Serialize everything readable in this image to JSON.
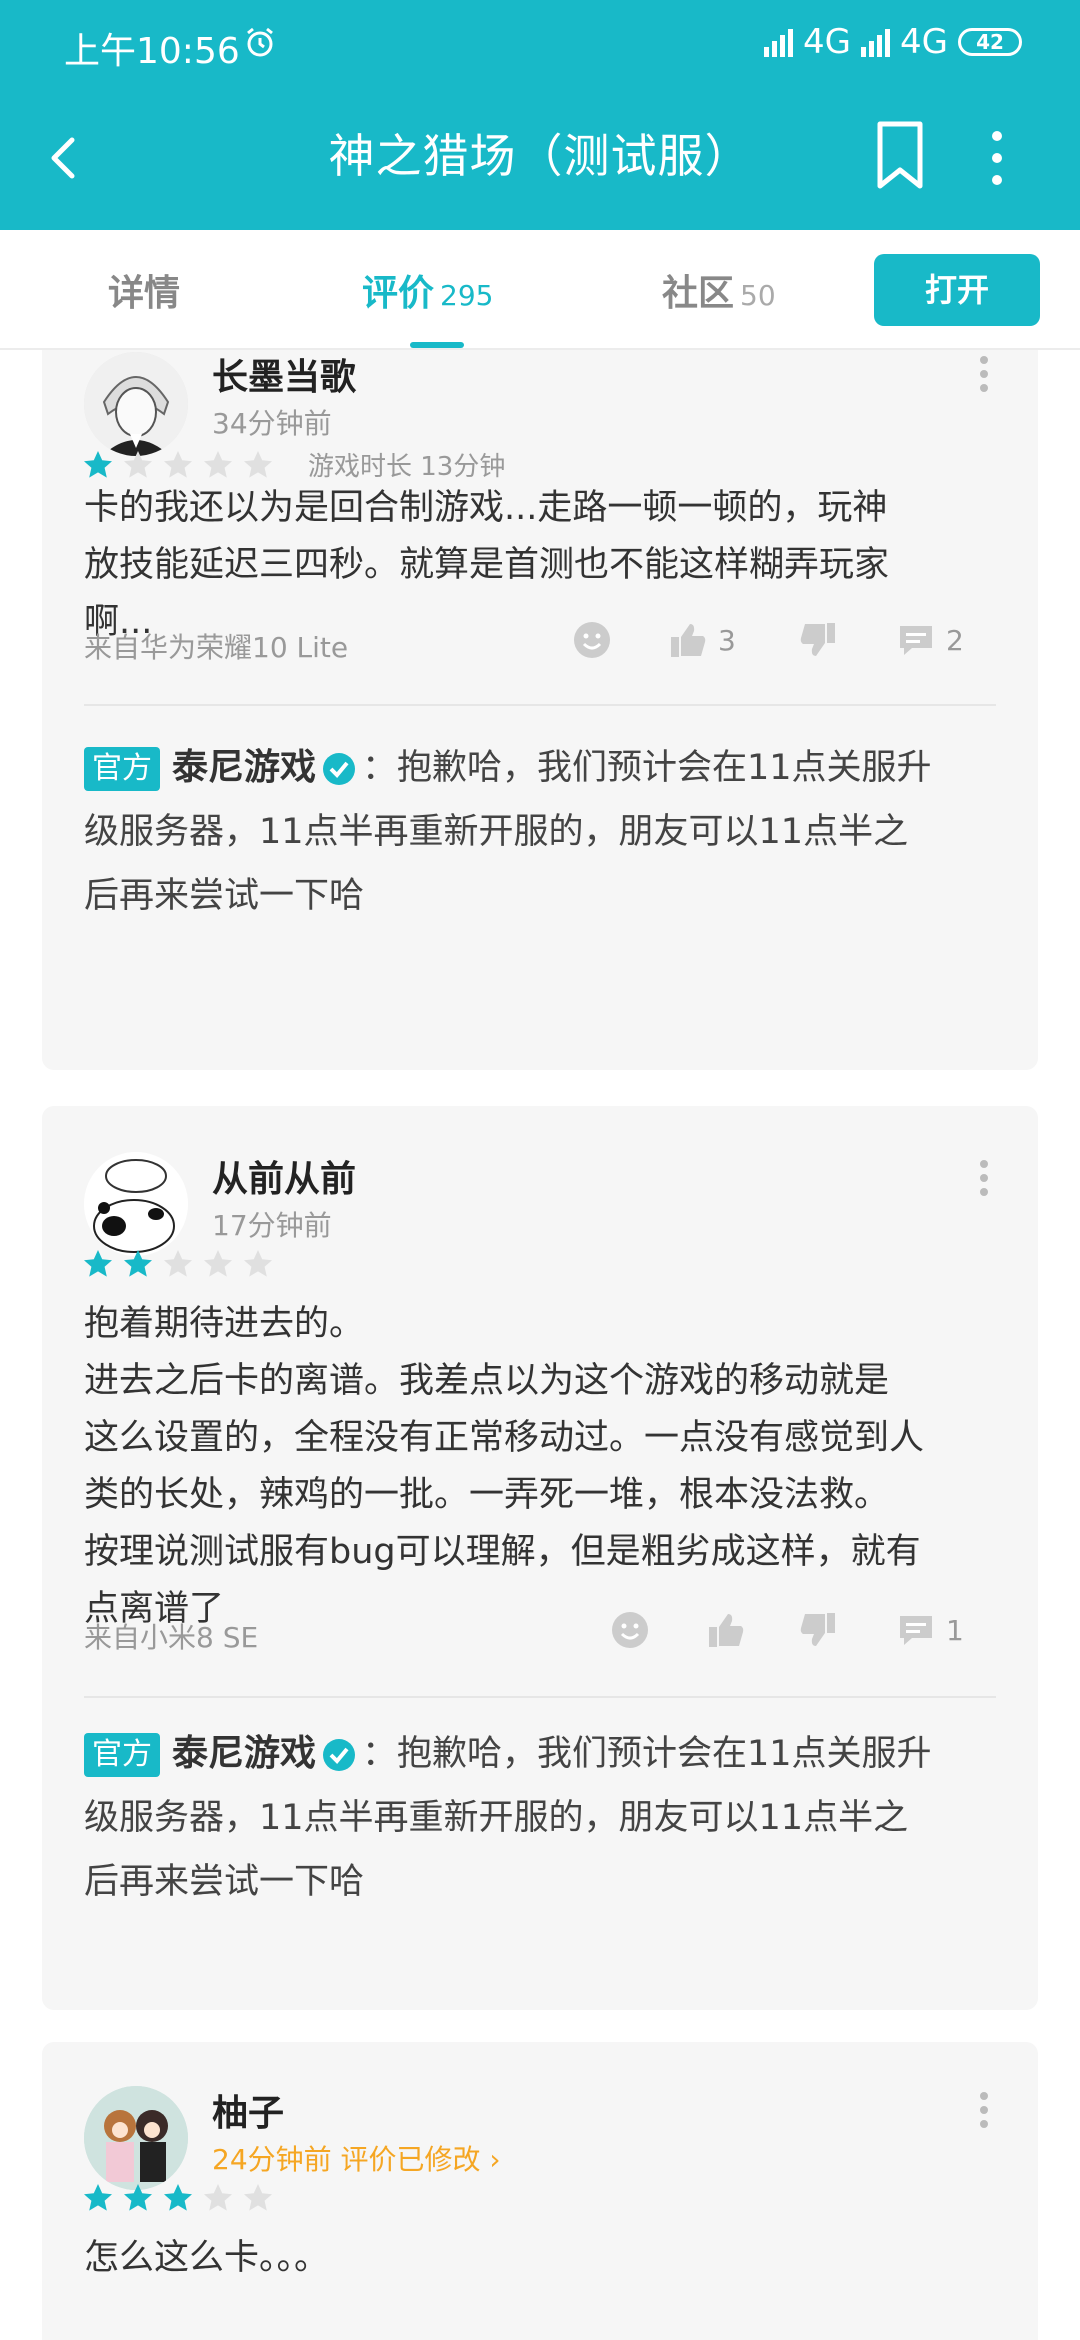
{
  "status": {
    "time": "上午10:56",
    "network1": "4G",
    "network2": "4G",
    "battery": "42"
  },
  "app_bar": {
    "title": "神之猎场（测试服）"
  },
  "tabs": [
    {
      "label": "详情",
      "count": ""
    },
    {
      "label": "评价",
      "count": "295"
    },
    {
      "label": "社区",
      "count": "50"
    }
  ],
  "open_button": "打开",
  "colors": {
    "accent": "#18b9c8",
    "star_empty": "#e0e0e0",
    "orange": "#f5a623"
  },
  "reviews": [
    {
      "username": "长墨当歌",
      "time": "34分钟前",
      "rating": 1,
      "playtime": "游戏时长 13分钟",
      "text": "卡的我还以为是回合制游戏...走路一顿一顿的，玩神\n放技能延迟三四秒。就算是首测也不能这样糊弄玩家\n啊...",
      "device": "来自华为荣耀10 Lite",
      "likes": "3",
      "comments": "2",
      "reply": {
        "badge": "官方",
        "developer": "泰尼游戏",
        "text": "：抱歉哈，我们预计会在11点关服升\n级服务器，11点半再重新开服的，朋友可以11点半之\n后再来尝试一下哈"
      }
    },
    {
      "username": "从前从前",
      "time": "17分钟前",
      "rating": 2,
      "playtime": "",
      "text": "抱着期待进去的。\n进去之后卡的离谱。我差点以为这个游戏的移动就是\n这么设置的，全程没有正常移动过。一点没有感觉到人\n类的长处，辣鸡的一批。一弄死一堆，根本没法救。\n按理说测试服有bug可以理解，但是粗劣成这样，就有\n点离谱了",
      "device": "来自小米8 SE",
      "likes": "",
      "comments": "1",
      "reply": {
        "badge": "官方",
        "developer": "泰尼游戏",
        "text": "：抱歉哈，我们预计会在11点关服升\n级服务器，11点半再重新开服的，朋友可以11点半之\n后再来尝试一下哈"
      }
    },
    {
      "username": "柚子",
      "time": "24分钟前 评价已修改 ›",
      "rating": 3,
      "playtime": "",
      "text": "怎么这么卡。。。"
    }
  ]
}
